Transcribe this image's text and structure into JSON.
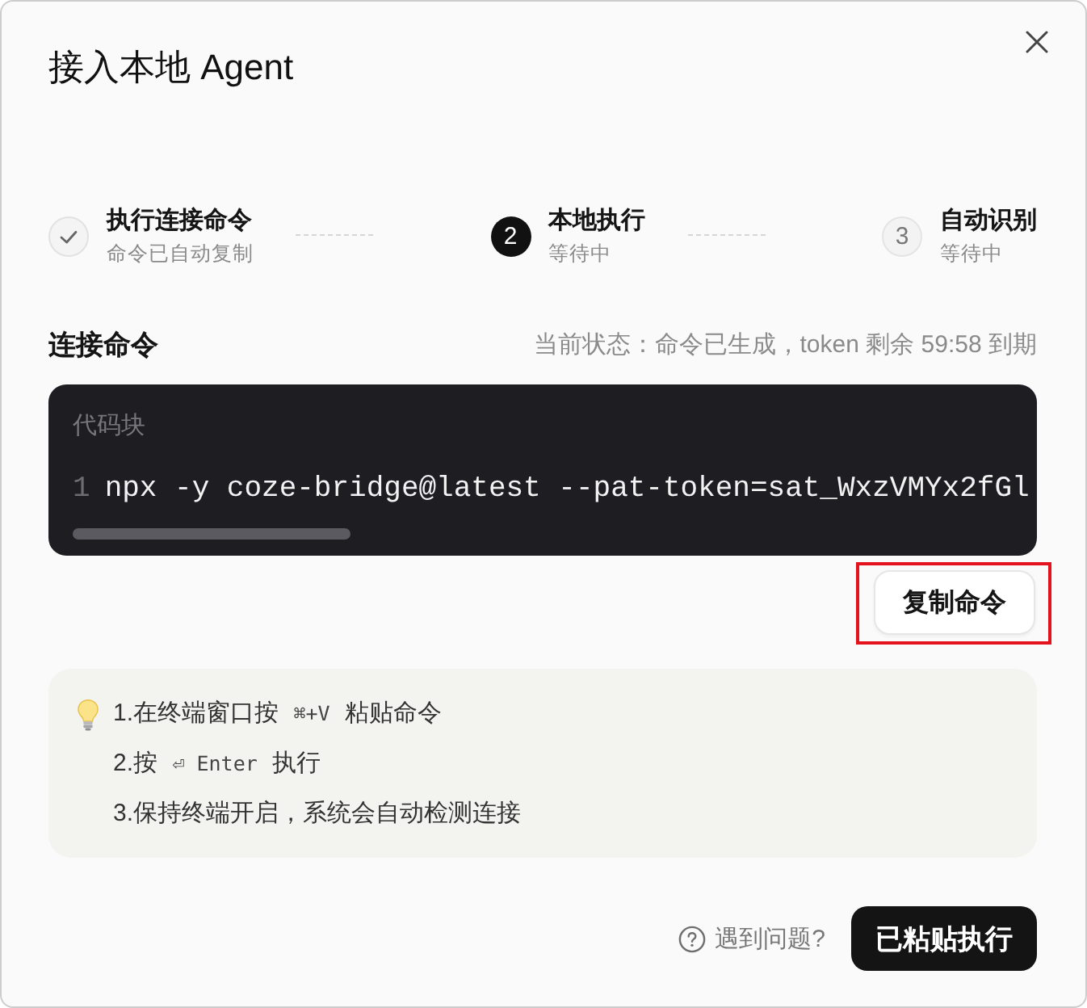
{
  "dialog": {
    "title": "接入本地 Agent"
  },
  "steps": [
    {
      "title": "执行连接命令",
      "subtitle": "命令已自动复制",
      "done": true,
      "current": false
    },
    {
      "number": "2",
      "title": "本地执行",
      "subtitle": "等待中",
      "done": false,
      "current": true
    },
    {
      "number": "3",
      "title": "自动识别",
      "subtitle": "等待中",
      "done": false,
      "current": false
    }
  ],
  "command_section": {
    "title": "连接命令",
    "status_text": "当前状态：命令已生成，token 剩余 59:58 到期",
    "code_block": {
      "label": "代码块",
      "lines": [
        {
          "number": "1",
          "code": "npx -y coze-bridge@latest --pat-token=sat_WxzVMYx2fGl"
        }
      ]
    },
    "copy_button": {
      "label": "复制命令",
      "highlighted": true
    }
  },
  "tips": [
    {
      "parts": [
        {
          "kind": "text",
          "text": "1.在终端窗口按"
        },
        {
          "kind": "key",
          "text": "⌘+V"
        },
        {
          "kind": "text",
          "text": "粘贴命令"
        }
      ]
    },
    {
      "parts": [
        {
          "kind": "text",
          "text": "2.按"
        },
        {
          "kind": "key",
          "text": "⏎ Enter"
        },
        {
          "kind": "text",
          "text": "执行"
        }
      ]
    },
    {
      "parts": [
        {
          "kind": "text",
          "text": "3.保持终端开启，系统会自动检测连接"
        }
      ]
    }
  ],
  "footer": {
    "help_link": "遇到问题?",
    "primary_button": "已粘贴执行"
  }
}
